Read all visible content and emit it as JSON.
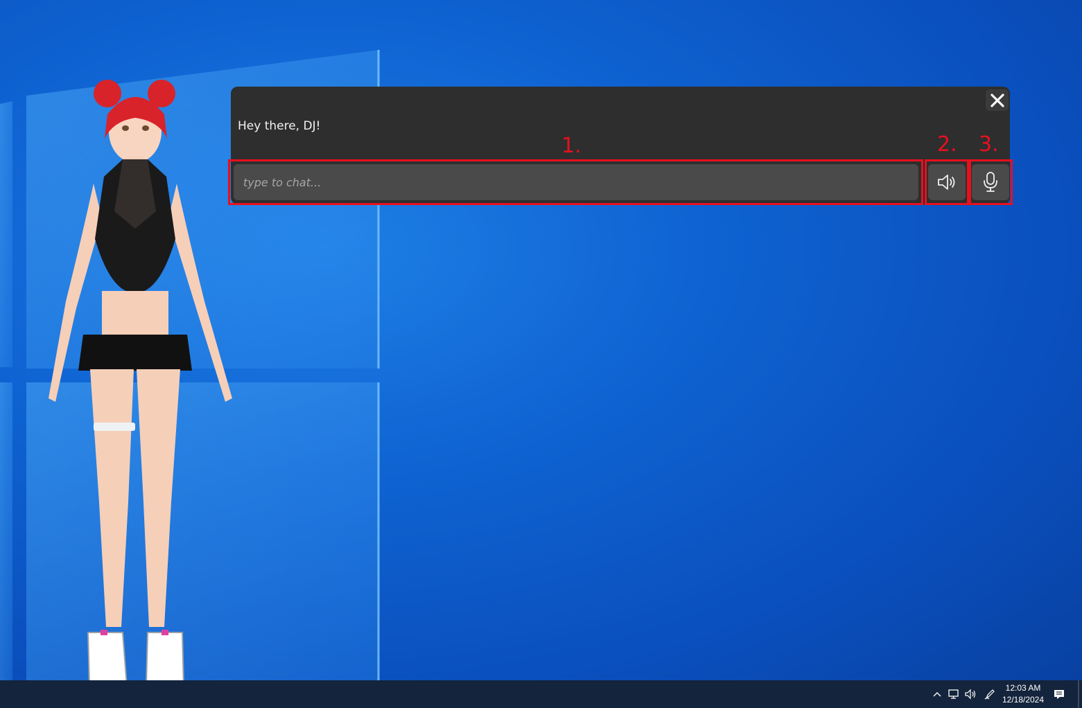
{
  "chat": {
    "message": "Hey there, DJ!",
    "input_placeholder": "type to chat...",
    "close_icon": "close-icon",
    "speaker_icon": "speaker-icon",
    "mic_icon": "microphone-icon"
  },
  "annotations": {
    "label_1": "1.",
    "label_2": "2.",
    "label_3": "3.",
    "color": "#e8101e"
  },
  "taskbar": {
    "time": "12:03 AM",
    "date": "12/18/2024",
    "tray_icons": [
      "chevron-up-icon",
      "network-icon",
      "volume-icon",
      "pen-icon",
      "notification-icon"
    ]
  },
  "colors": {
    "desktop_blue": "#0a4fbd",
    "panel_bg": "#2e2e2e",
    "input_bg": "#4a4a4a",
    "taskbar_bg": "#14243c"
  }
}
